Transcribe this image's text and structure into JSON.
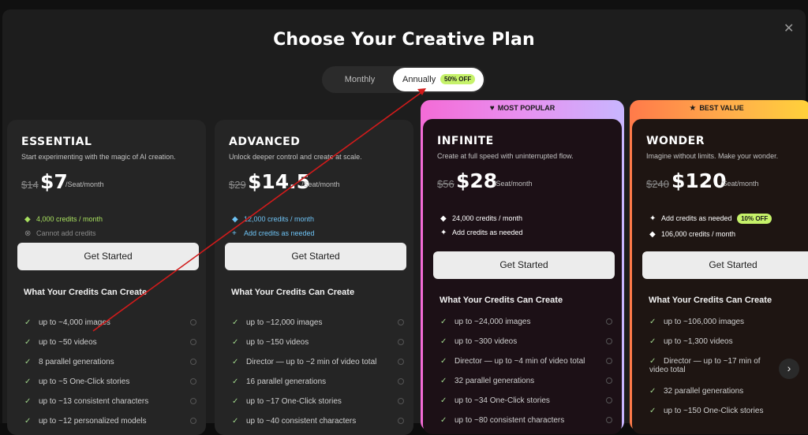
{
  "title": "Choose Your Creative Plan",
  "toggle": {
    "monthly": "Monthly",
    "annually": "Annually",
    "discount": "50% OFF"
  },
  "plans": [
    {
      "name": "ESSENTIAL",
      "desc": "Start experimenting with the magic of AI creation.",
      "old_price": "$14",
      "price": "$7",
      "per": "/Seat/month",
      "feat1": "4,000 credits / month",
      "feat1_color": "#a8e05f",
      "feat2": "Cannot add credits",
      "feat2_color": "#8a8a8a",
      "button": "Get Started",
      "section": "What Your Credits Can Create",
      "items": [
        "up to ~4,000 images",
        "up to ~50 videos",
        "8 parallel generations",
        "up to ~5 One-Click stories",
        "up to ~13 consistent characters",
        "up to ~12 personalized models"
      ]
    },
    {
      "name": "ADVANCED",
      "desc": "Unlock deeper control and create at scale.",
      "old_price": "$29",
      "price": "$14.5",
      "per": "/Seat/month",
      "feat1": "12,000 credits / month",
      "feat1_color": "#6ec3f5",
      "feat2": "Add credits as needed",
      "feat2_color": "#6ec3f5",
      "button": "Get Started",
      "section": "What Your Credits Can Create",
      "items": [
        "up to ~12,000 images",
        "up to ~150 videos",
        "Director — up to ~2 min of video total",
        "16 parallel generations",
        "up to ~17 One-Click stories",
        "up to ~40 consistent characters"
      ]
    },
    {
      "ribbon": "MOST POPULAR",
      "name": "INFINITE",
      "desc": "Create at full speed with uninterrupted flow.",
      "old_price": "$56",
      "price": "$28",
      "per": "/Seat/month",
      "feat1": "24,000 credits / month",
      "feat1_color": "#ffffff",
      "feat2": "Add credits as needed",
      "feat2_color": "#ffffff",
      "button": "Get Started",
      "section": "What Your Credits Can Create",
      "items": [
        "up to ~24,000 images",
        "up to ~300 videos",
        "Director — up to ~4 min of video total",
        "32 parallel generations",
        "up to ~34 One-Click stories",
        "up to ~80 consistent characters"
      ]
    },
    {
      "ribbon": "BEST VALUE",
      "name": "WONDER",
      "desc": "Imagine without limits. Make your wonder.",
      "old_price": "$240",
      "price": "$120",
      "per": "/Seat/month",
      "feat1": "Add credits as needed",
      "feat1_badge": "10% OFF",
      "feat1_color": "#ffffff",
      "feat2": "106,000 credits / month",
      "feat2_color": "#ffffff",
      "button": "Get Started",
      "section": "What Your Credits Can Create",
      "items": [
        "up to ~106,000 images",
        "up to ~1,300 videos",
        "Director — up to ~17 min of video total",
        "32 parallel generations",
        "up to ~150 One-Click stories"
      ]
    }
  ],
  "colors": {
    "annotation_arrow": "#d11b1b",
    "check": "#9fd48a"
  }
}
